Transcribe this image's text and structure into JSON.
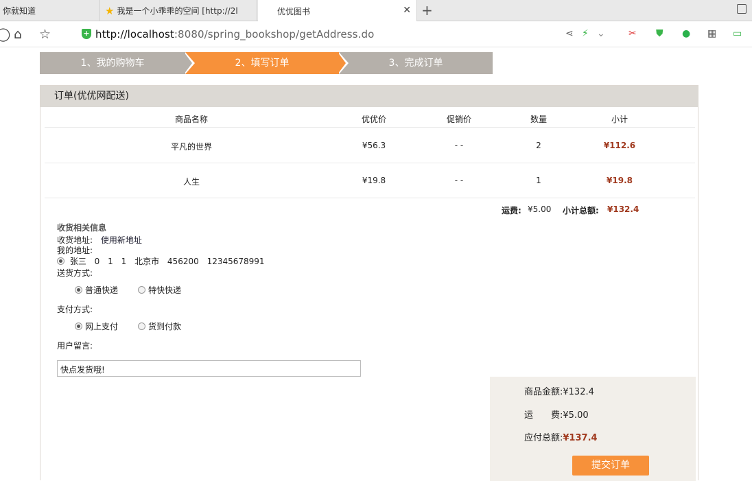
{
  "browser": {
    "tabs": [
      {
        "title": "你就知道"
      },
      {
        "title": "我是一个小乖乖的空间 [http://2l"
      },
      {
        "title": "优优图书"
      }
    ],
    "url_host": "http://localhost",
    "url_rest": ":8080/spring_bookshop/getAddress.do"
  },
  "steps": [
    "1、我的购物车",
    "2、填写订单",
    "3、完成订单"
  ],
  "order": {
    "title": "订单(优优网配送)",
    "columns": [
      "商品名称",
      "优优价",
      "促销价",
      "数量",
      "小计"
    ],
    "items": [
      {
        "name": "平凡的世界",
        "price": "¥56.3",
        "promo": "- -",
        "qty": "2",
        "subtotal": "¥112.6"
      },
      {
        "name": "人生",
        "price": "¥19.8",
        "promo": "- -",
        "qty": "1",
        "subtotal": "¥19.8"
      }
    ],
    "freight_label": "运费:",
    "freight_value": "¥5.00",
    "total_label": "小计总额:",
    "total_value": "¥132.4"
  },
  "shipping": {
    "section_title": "收货相关信息",
    "address_label": "收货地址:",
    "new_address_link": "使用新地址",
    "my_address_label": "我的地址:",
    "address": {
      "name": "张三",
      "f1": "0",
      "f2": "1",
      "f3": "1",
      "city": "北京市",
      "zip": "456200",
      "phone": "12345678991"
    },
    "delivery_label": "送货方式:",
    "delivery_options": [
      "普通快递",
      "特快快递"
    ],
    "payment_label": "支付方式:",
    "payment_options": [
      "网上支付",
      "货到付款"
    ],
    "message_label": "用户留言:",
    "message_value": "快点发货哦!"
  },
  "summary": {
    "goods_label": "商品金额:",
    "goods_value": "¥132.4",
    "freight_label": "运　　费:",
    "freight_value": "¥5.00",
    "payable_label": "应付总额:",
    "payable_value": "¥137.4",
    "submit_label": "提交订单"
  },
  "colors": {
    "accent": "#f7913a",
    "step_inactive": "#b5b0aa",
    "price_red": "#a0391e"
  }
}
